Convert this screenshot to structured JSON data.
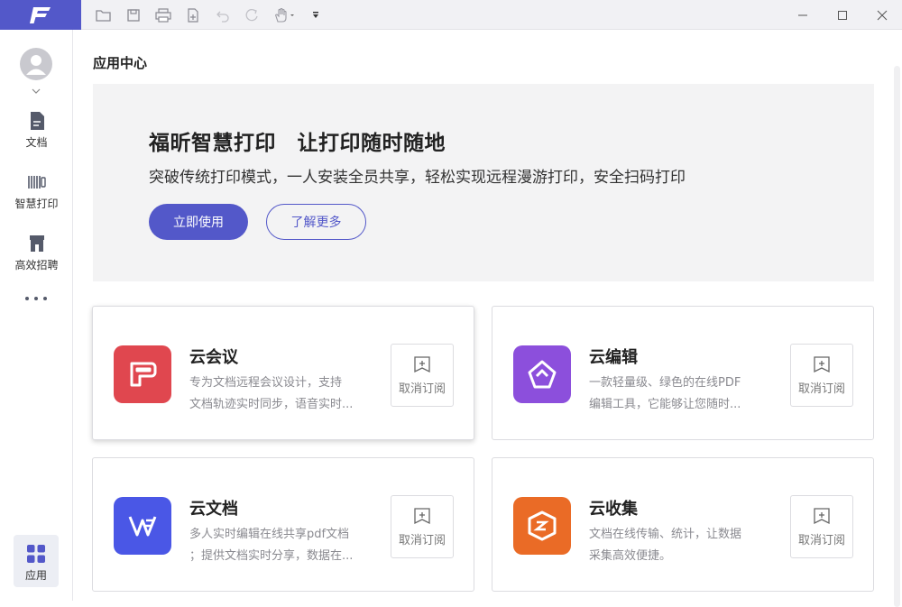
{
  "toolbar": {
    "icons": [
      "open-folder-icon",
      "save-icon",
      "print-icon",
      "new-document-icon",
      "undo-icon",
      "redo-icon",
      "hand-tool-icon",
      "customize-toolbar-icon"
    ]
  },
  "window": {
    "controls": [
      "minimize-icon",
      "maximize-icon",
      "close-icon"
    ]
  },
  "sidebar": {
    "items": [
      {
        "label": "文档",
        "icon": "document-icon"
      },
      {
        "label": "智慧打印",
        "icon": "smart-print-icon"
      },
      {
        "label": "高效招聘",
        "icon": "recruit-icon"
      }
    ],
    "more_icon": "more-icon",
    "app": {
      "label": "应用",
      "icon": "apps-grid-icon"
    }
  },
  "main": {
    "title": "应用中心",
    "banner": {
      "title": "福昕智慧打印　让打印随时随地",
      "subtitle": "突破传统打印模式，一人安装全员共享，轻松实现远程漫游打印，安全扫码打印",
      "primary_button": "立即使用",
      "secondary_button": "了解更多"
    },
    "cards": [
      {
        "name": "云会议",
        "desc_line1": "专为文档远程会议设计，支持",
        "desc_line2": "文档轨迹实时同步，语音实时...",
        "button": "取消订阅",
        "icon": "cloud-meeting-icon",
        "color": "#e0474f"
      },
      {
        "name": "云编辑",
        "desc_line1": "一款轻量级、绿色的在线PDF",
        "desc_line2": "编辑工具，它能够让您随时...",
        "button": "取消订阅",
        "icon": "cloud-edit-icon",
        "color": "#8c4fdc"
      },
      {
        "name": "云文档",
        "desc_line1": "多人实时编辑在线共享pdf文档",
        "desc_line2": "；提供文档实时分享，数据在...",
        "button": "取消订阅",
        "icon": "cloud-docs-icon",
        "color": "#4a57e6"
      },
      {
        "name": "云收集",
        "desc_line1": "文档在线传输、统计，让数据",
        "desc_line2": "采集高效便捷。",
        "button": "取消订阅",
        "icon": "cloud-collect-icon",
        "color": "#ea6b26"
      }
    ]
  },
  "colors": {
    "brand": "#5358c9",
    "banner_bg": "#f3f3f4"
  }
}
